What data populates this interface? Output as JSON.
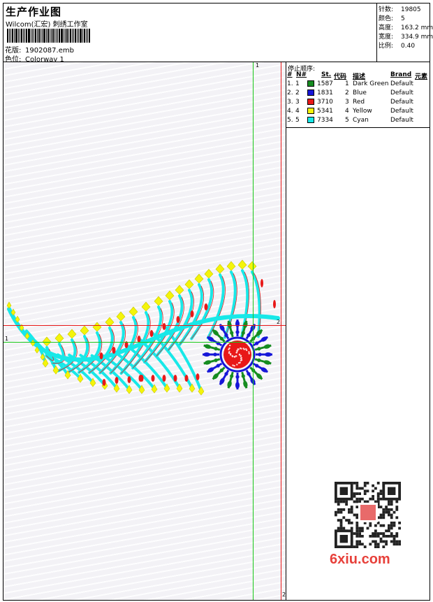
{
  "header": {
    "title": "生产作业图",
    "subtitle": "Wilcom(汇宏) 刺绣工作室",
    "design_label": "花版:",
    "design_file": "1902087.emb",
    "colorway_label": "色位:",
    "colorway": "Colorway 1"
  },
  "stats": [
    {
      "label": "针数:",
      "value": "19805"
    },
    {
      "label": "颜色:",
      "value": "5"
    },
    {
      "label": "高度:",
      "value": "163.2 mm"
    },
    {
      "label": "宽度:",
      "value": "334.9 mm"
    },
    {
      "label": "比例:",
      "value": "0.40"
    }
  ],
  "stop_sequence": {
    "title": "停止顺序:",
    "columns": [
      "#",
      "N#",
      "St.",
      "代码",
      "描述",
      "Brand",
      "元素"
    ],
    "rows": [
      {
        "index": "1.",
        "n": "1",
        "color": "#168c20",
        "st": "1587",
        "code": "1",
        "desc": "Dark Green",
        "brand": "Default"
      },
      {
        "index": "2.",
        "n": "2",
        "color": "#1616d8",
        "st": "1831",
        "code": "2",
        "desc": "Blue",
        "brand": "Default"
      },
      {
        "index": "3.",
        "n": "3",
        "color": "#e81818",
        "st": "3710",
        "code": "3",
        "desc": "Red",
        "brand": "Default"
      },
      {
        "index": "4.",
        "n": "4",
        "color": "#f4f40a",
        "st": "5341",
        "code": "4",
        "desc": "Yellow",
        "brand": "Default"
      },
      {
        "index": "5.",
        "n": "5",
        "color": "#18e8e8",
        "st": "7334",
        "code": "5",
        "desc": "Cyan",
        "brand": "Default"
      }
    ]
  },
  "markers": {
    "top": "1",
    "left": "1",
    "right": "2",
    "bottom": "2"
  },
  "watermark": "6xiu.com",
  "colors": {
    "guide_green": "#18c818",
    "guide_red": "#e81818"
  }
}
